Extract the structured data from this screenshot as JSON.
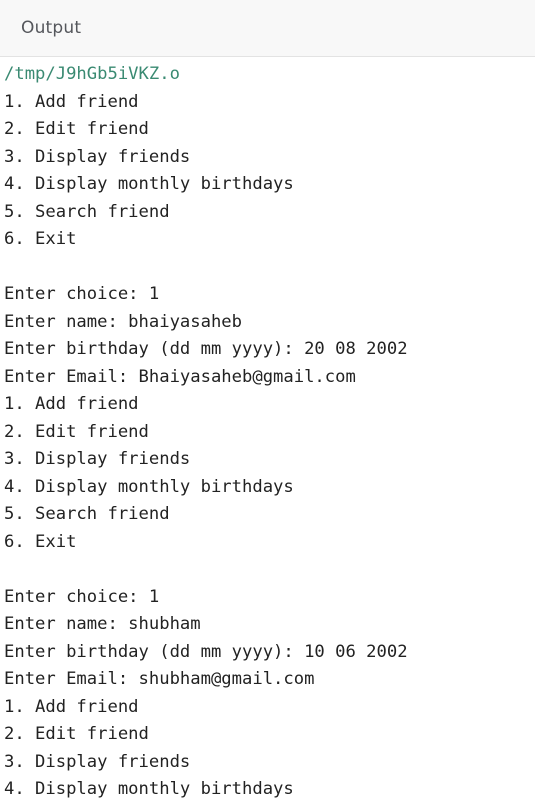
{
  "panel": {
    "title": "Output"
  },
  "output": {
    "lines": [
      {
        "text": "/tmp/J9hGb5iVKZ.o",
        "kind": "path"
      },
      {
        "text": "1. Add friend",
        "kind": "normal"
      },
      {
        "text": "2. Edit friend",
        "kind": "normal"
      },
      {
        "text": "3. Display friends",
        "kind": "normal"
      },
      {
        "text": "4. Display monthly birthdays",
        "kind": "normal"
      },
      {
        "text": "5. Search friend",
        "kind": "normal"
      },
      {
        "text": "6. Exit",
        "kind": "normal"
      },
      {
        "text": "",
        "kind": "normal"
      },
      {
        "text": "Enter choice: 1",
        "kind": "normal"
      },
      {
        "text": "Enter name: bhaiyasaheb",
        "kind": "normal"
      },
      {
        "text": "Enter birthday (dd mm yyyy): 20 08 2002",
        "kind": "normal"
      },
      {
        "text": "Enter Email: Bhaiyasaheb@gmail.com",
        "kind": "normal"
      },
      {
        "text": "1. Add friend",
        "kind": "normal"
      },
      {
        "text": "2. Edit friend",
        "kind": "normal"
      },
      {
        "text": "3. Display friends",
        "kind": "normal"
      },
      {
        "text": "4. Display monthly birthdays",
        "kind": "normal"
      },
      {
        "text": "5. Search friend",
        "kind": "normal"
      },
      {
        "text": "6. Exit",
        "kind": "normal"
      },
      {
        "text": "",
        "kind": "normal"
      },
      {
        "text": "Enter choice: 1",
        "kind": "normal"
      },
      {
        "text": "Enter name: shubham",
        "kind": "normal"
      },
      {
        "text": "Enter birthday (dd mm yyyy): 10 06 2002",
        "kind": "normal"
      },
      {
        "text": "Enter Email: shubham@gmail.com",
        "kind": "normal"
      },
      {
        "text": "1. Add friend",
        "kind": "normal"
      },
      {
        "text": "2. Edit friend",
        "kind": "normal"
      },
      {
        "text": "3. Display friends",
        "kind": "normal"
      },
      {
        "text": "4. Display monthly birthdays",
        "kind": "normal"
      }
    ]
  },
  "colors": {
    "path_text": "#3a8a72",
    "console_text": "#222222",
    "header_text": "#55575c",
    "header_background": "#f8f8f8"
  }
}
